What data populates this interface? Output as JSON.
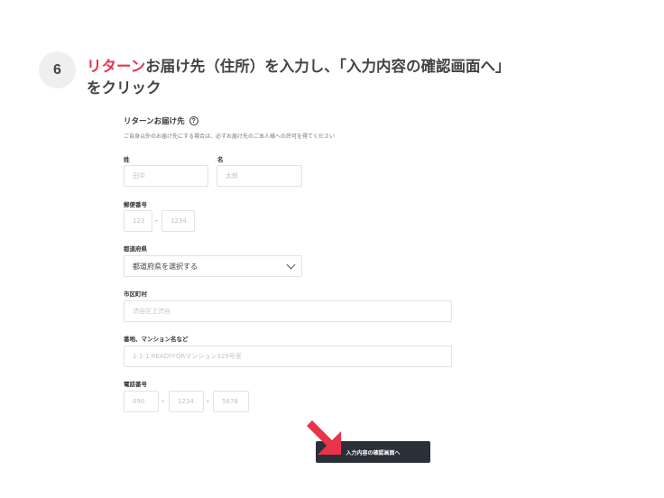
{
  "step": {
    "number": "6",
    "title_accent": "リターン",
    "title_rest": "お届け先（住所）を入力し、「入力内容の確認画面へ」",
    "title_line2": "をクリック"
  },
  "form": {
    "section_title": "リターンお届け先",
    "help_icon": "?",
    "description": "ご自身以外のお届け先にする場合は、必ずお届け先のご本人様への許可を得てください",
    "last_name": {
      "label": "姓",
      "placeholder": "田中"
    },
    "first_name": {
      "label": "名",
      "placeholder": "太郎"
    },
    "postal": {
      "label": "郵便番号",
      "placeholder1": "123",
      "separator": "-",
      "placeholder2": "1234"
    },
    "prefecture": {
      "label": "都道府県",
      "value": "都道府県を選択する"
    },
    "city": {
      "label": "市区町村",
      "placeholder": "渋谷区上渋谷"
    },
    "address": {
      "label": "番地、マンション名など",
      "placeholder": "1-1-1 READYFORマンション329号室"
    },
    "phone": {
      "label": "電話番号",
      "placeholder1": "090",
      "placeholder2": "1234",
      "placeholder3": "5678",
      "separator": "-"
    }
  },
  "confirm_button": "入力内容の確認画面へ",
  "colors": {
    "accent": "#e8334a",
    "button": "#2b2f38",
    "arrow": "#e8334a"
  }
}
